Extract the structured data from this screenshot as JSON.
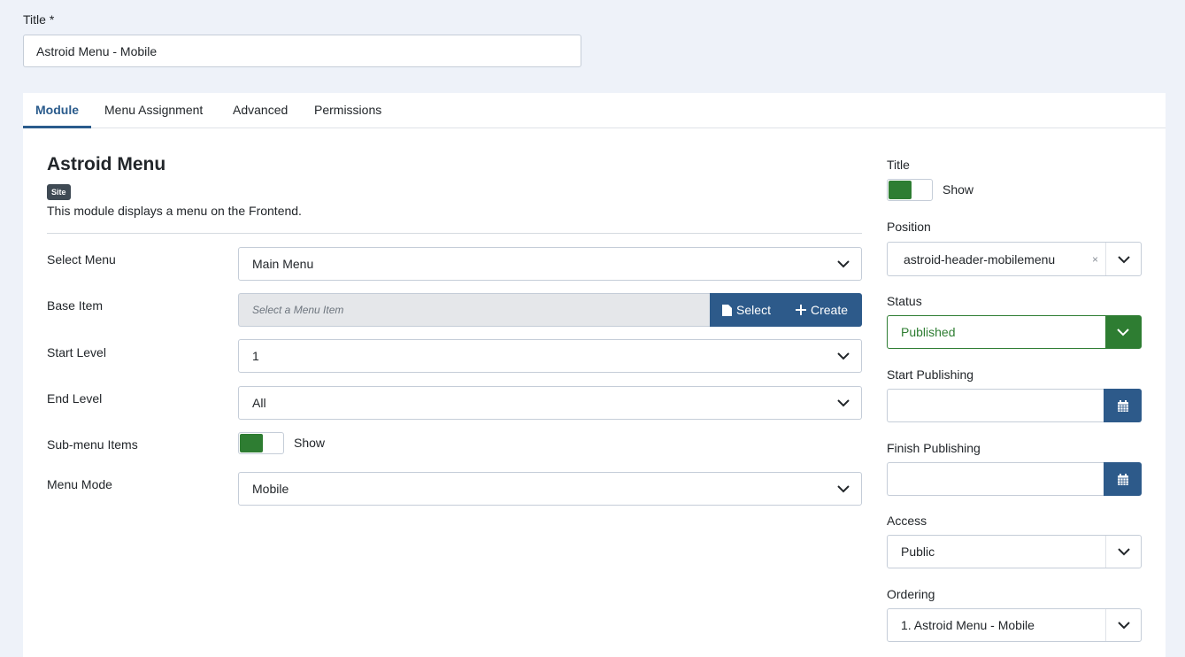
{
  "title_field": {
    "label": "Title *",
    "value": "Astroid Menu - Mobile"
  },
  "tabs": [
    {
      "label": "Module"
    },
    {
      "label": "Menu Assignment"
    },
    {
      "label": "Advanced"
    },
    {
      "label": "Permissions"
    }
  ],
  "module": {
    "name": "Astroid Menu",
    "badge": "Site",
    "description": "This module displays a menu on the Frontend."
  },
  "form": {
    "select_menu": {
      "label": "Select Menu",
      "value": "Main Menu"
    },
    "base_item": {
      "label": "Base Item",
      "placeholder": "Select a Menu Item",
      "select_label": "Select",
      "create_label": "Create"
    },
    "start_level": {
      "label": "Start Level",
      "value": "1"
    },
    "end_level": {
      "label": "End Level",
      "value": "All"
    },
    "submenu_items": {
      "label": "Sub-menu Items",
      "state": "Show"
    },
    "menu_mode": {
      "label": "Menu Mode",
      "value": "Mobile"
    }
  },
  "sidebar": {
    "title": {
      "label": "Title",
      "state": "Show"
    },
    "position": {
      "label": "Position",
      "value": "astroid-header-mobilemenu",
      "clear": "×"
    },
    "status": {
      "label": "Status",
      "value": "Published"
    },
    "start_publishing": {
      "label": "Start Publishing",
      "value": ""
    },
    "finish_publishing": {
      "label": "Finish Publishing",
      "value": ""
    },
    "access": {
      "label": "Access",
      "value": "Public"
    },
    "ordering": {
      "label": "Ordering",
      "value": "1. Astroid Menu - Mobile"
    }
  },
  "colors": {
    "accent": "#2d5a8a",
    "success": "#2e7d32",
    "background": "#eef2f9"
  }
}
